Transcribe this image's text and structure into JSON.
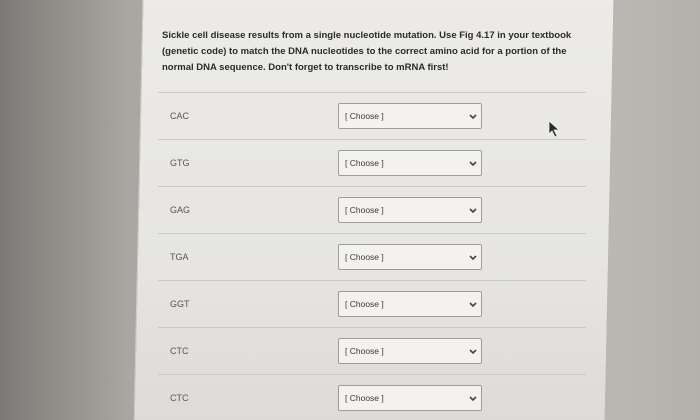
{
  "question": {
    "text": "Sickle cell disease results from a single nucleotide mutation. Use Fig 4.17 in your textbook (genetic code) to match the DNA nucleotides to the correct amino acid for a portion of the normal DNA sequence. Don't forget to transcribe to mRNA first!"
  },
  "matches": [
    {
      "codon": "CAC",
      "selected": "[ Choose ]"
    },
    {
      "codon": "GTG",
      "selected": "[ Choose ]"
    },
    {
      "codon": "GAG",
      "selected": "[ Choose ]"
    },
    {
      "codon": "TGA",
      "selected": "[ Choose ]"
    },
    {
      "codon": "GGT",
      "selected": "[ Choose ]"
    },
    {
      "codon": "CTC",
      "selected": "[ Choose ]"
    },
    {
      "codon": "CTC",
      "selected": "[ Choose ]"
    }
  ],
  "icons": {
    "dropdown": "chevron-down-icon",
    "pointer": "mouse-cursor-icon"
  }
}
